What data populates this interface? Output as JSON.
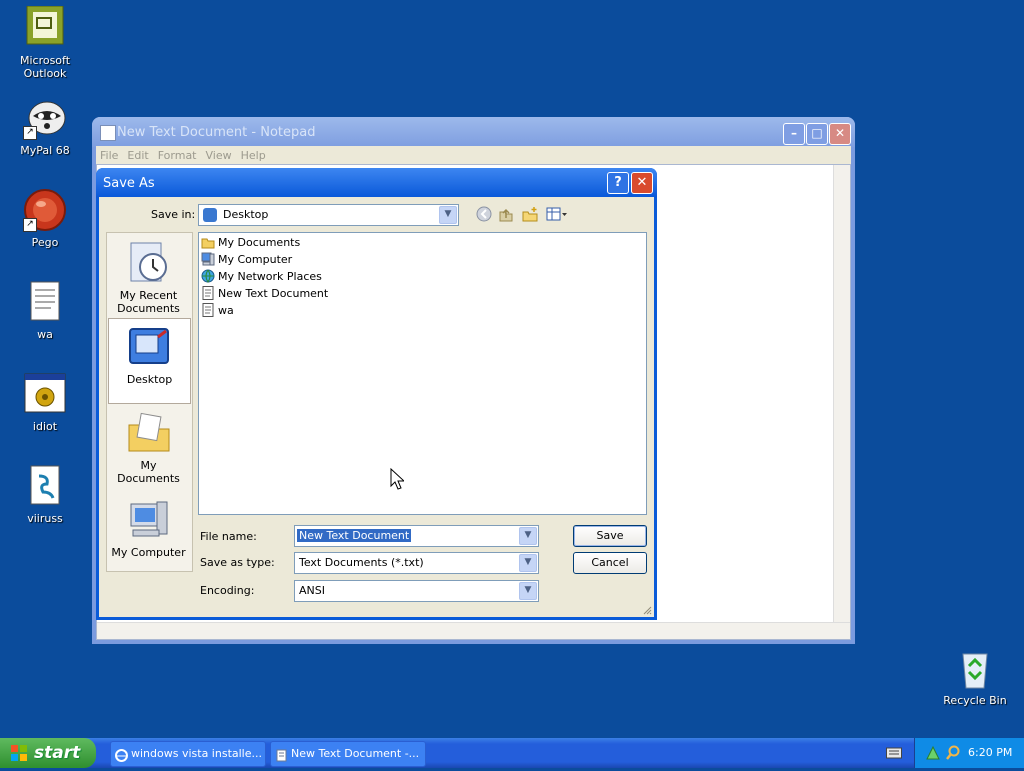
{
  "desktop": {
    "icons": [
      {
        "label": "Microsoft Outlook"
      },
      {
        "label": "MyPal 68"
      },
      {
        "label": "Pego"
      },
      {
        "label": "wa"
      },
      {
        "label": "idiot"
      },
      {
        "label": "viiruss"
      },
      {
        "label": "Recycle Bin"
      }
    ]
  },
  "notepad": {
    "title": "New Text Document - Notepad",
    "menu": [
      "File",
      "Edit",
      "Format",
      "View",
      "Help"
    ]
  },
  "dialog": {
    "title": "Save As",
    "save_in_label": "Save in:",
    "save_in_value": "Desktop",
    "places": [
      {
        "label_1": "My Recent",
        "label_2": "Documents"
      },
      {
        "label_1": "Desktop"
      },
      {
        "label_1": "My Documents"
      },
      {
        "label_1": "My Computer"
      }
    ],
    "files": [
      {
        "name": "My Documents"
      },
      {
        "name": "My Computer"
      },
      {
        "name": "My Network Places"
      },
      {
        "name": "New Text Document"
      },
      {
        "name": "wa"
      }
    ],
    "file_name_label": "File name:",
    "file_name_value": "New Text Document",
    "save_type_label": "Save as type:",
    "save_type_value": "Text Documents (*.txt)",
    "encoding_label": "Encoding:",
    "encoding_value": "ANSI",
    "save_label": "Save",
    "cancel_label": "Cancel",
    "help_label": "?",
    "close_label": "✕"
  },
  "taskbar": {
    "start_label": "start",
    "tasks": [
      {
        "label": "windows vista installe..."
      },
      {
        "label": "New Text Document -..."
      }
    ],
    "clock": "6:20 PM"
  },
  "colors": {
    "desktop": "#0b4c9c",
    "titlebar_active": "#0857d8",
    "selection": "#316ac5"
  }
}
